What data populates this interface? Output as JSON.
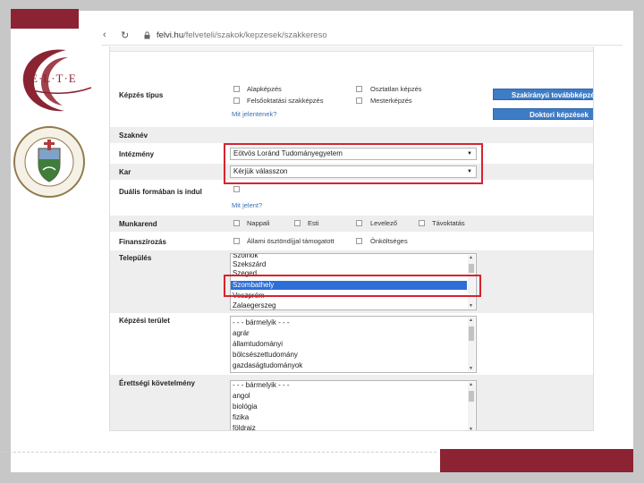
{
  "browser": {
    "url_host": "felvi.hu",
    "url_path": "/felveteli/szakok/kepzesek/szakkereso",
    "back_icon": "back-arrow-icon",
    "reload_icon": "reload-icon",
    "lock_icon": "lock-icon"
  },
  "branding": {
    "elte_logo_text": "E·L·T·E",
    "accent_color": "#8b2332"
  },
  "form": {
    "kepzes_tipus": {
      "label": "Képzés típus",
      "options": [
        "Alapképzés",
        "Osztatlan képzés",
        "Felsőoktatási szakképzés",
        "Mesterképzés"
      ],
      "help_link": "Mit jelentenek?"
    },
    "buttons": {
      "szakiranyu": "Szakirányú továbbképzések",
      "doktori": "Doktori képzések"
    },
    "szaknev": {
      "label": "Szaknév",
      "value": ""
    },
    "intezmeny": {
      "label": "Intézmény",
      "value": "Eötvös Loránd Tudományegyetem"
    },
    "kar": {
      "label": "Kar",
      "value": "Kérjük válasszon"
    },
    "dualis": {
      "label": "Duális formában is indul",
      "help_link": "Mit jelent?"
    },
    "munkarend": {
      "label": "Munkarend",
      "options": [
        "Nappali",
        "Esti",
        "Levelező",
        "Távoktatás"
      ]
    },
    "finanszirozas": {
      "label": "Finanszírozás",
      "options": [
        "Állami ösztöndíjjal támogatott",
        "Önköltséges"
      ]
    },
    "telepules": {
      "label": "Település",
      "items": [
        "Szolnok",
        "Szekszárd",
        "Szeged",
        "Szombathely",
        "Veszprém",
        "Zalaegerszeg"
      ],
      "selected": "Szombathely"
    },
    "kepzesi_terulet": {
      "label": "Képzési terület",
      "items": [
        "- - - bármelyik - - -",
        "agrár",
        "államtudományi",
        "bölcsészettudomány",
        "gazdaságtudományok"
      ]
    },
    "erettsegi": {
      "label": "Érettségi követelmény",
      "items": [
        "- - - bármelyik - - -",
        "angol",
        "biológia",
        "fizika",
        "földrajz"
      ]
    }
  }
}
